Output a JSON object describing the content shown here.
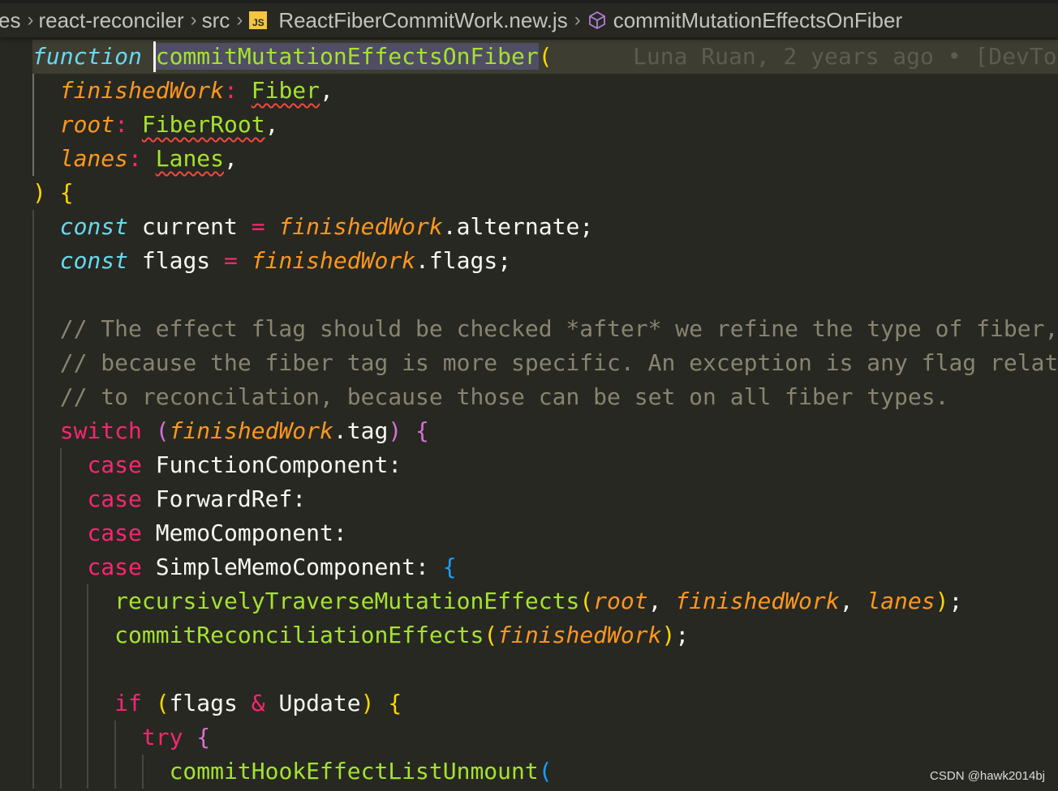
{
  "breadcrumb": {
    "items": [
      "es",
      "react-reconciler",
      "src",
      "ReactFiberCommitWork.new.js",
      "commitMutationEffectsOnFiber"
    ],
    "file_icon_label": "JS",
    "file_icon": "javascript-file-icon",
    "symbol_icon": "cube-symbol-icon"
  },
  "palette": {
    "fn": "#a6e22e",
    "kw": "#66d9ef",
    "param": "#fd971f",
    "pink": "#f92672",
    "txt": "#f8f8f2",
    "cm": "#88846f",
    "b1": "#ffd700",
    "b2": "#da70d6",
    "b3": "#179fff",
    "type": "#a6e22e"
  },
  "blame": "Luna Ruan, 2 years ago • [DevTo",
  "code": {
    "lines": [
      [
        [
          "function",
          "kw",
          1
        ],
        [
          " ",
          "txt"
        ],
        [
          "commitMutationEffectsOnFiber",
          "fn",
          0,
          "sel"
        ],
        [
          "(",
          "b1"
        ]
      ],
      [
        [
          "  ",
          "txt"
        ],
        [
          "finishedWork",
          "param",
          1
        ],
        [
          ":",
          "pink"
        ],
        [
          " ",
          "txt"
        ],
        [
          "Fiber",
          "type",
          0,
          "squig"
        ],
        [
          ",",
          "txt"
        ]
      ],
      [
        [
          "  ",
          "txt"
        ],
        [
          "root",
          "param",
          1
        ],
        [
          ":",
          "pink"
        ],
        [
          " ",
          "txt"
        ],
        [
          "FiberRoot",
          "type",
          0,
          "squig"
        ],
        [
          ",",
          "txt"
        ]
      ],
      [
        [
          "  ",
          "txt"
        ],
        [
          "lanes",
          "param",
          1
        ],
        [
          ":",
          "pink"
        ],
        [
          " ",
          "txt"
        ],
        [
          "Lanes",
          "type",
          0,
          "squig"
        ],
        [
          ",",
          "txt"
        ]
      ],
      [
        [
          ")",
          "b1"
        ],
        [
          " ",
          "txt"
        ],
        [
          "{",
          "b1"
        ]
      ],
      [
        [
          "  ",
          "txt"
        ],
        [
          "const",
          "kw",
          1
        ],
        [
          " current ",
          "txt"
        ],
        [
          "=",
          "pink"
        ],
        [
          " ",
          "txt"
        ],
        [
          "finishedWork",
          "param",
          1
        ],
        [
          ".alternate;",
          "txt"
        ]
      ],
      [
        [
          "  ",
          "txt"
        ],
        [
          "const",
          "kw",
          1
        ],
        [
          " flags ",
          "txt"
        ],
        [
          "=",
          "pink"
        ],
        [
          " ",
          "txt"
        ],
        [
          "finishedWork",
          "param",
          1
        ],
        [
          ".flags;",
          "txt"
        ]
      ],
      [],
      [
        [
          "  // The effect flag should be checked *after* we refine the type of fiber,",
          "cm"
        ]
      ],
      [
        [
          "  // because the fiber tag is more specific. An exception is any flag relat",
          "cm"
        ]
      ],
      [
        [
          "  // to reconcilation, because those can be set on all fiber types.",
          "cm"
        ]
      ],
      [
        [
          "  ",
          "txt"
        ],
        [
          "switch",
          "pink"
        ],
        [
          " ",
          "txt"
        ],
        [
          "(",
          "b2"
        ],
        [
          "finishedWork",
          "param",
          1
        ],
        [
          ".tag",
          "txt"
        ],
        [
          ")",
          "b2"
        ],
        [
          " ",
          "txt"
        ],
        [
          "{",
          "b2"
        ]
      ],
      [
        [
          "    ",
          "txt"
        ],
        [
          "case",
          "pink"
        ],
        [
          " FunctionComponent:",
          "txt"
        ]
      ],
      [
        [
          "    ",
          "txt"
        ],
        [
          "case",
          "pink"
        ],
        [
          " ForwardRef:",
          "txt"
        ]
      ],
      [
        [
          "    ",
          "txt"
        ],
        [
          "case",
          "pink"
        ],
        [
          " MemoComponent:",
          "txt"
        ]
      ],
      [
        [
          "    ",
          "txt"
        ],
        [
          "case",
          "pink"
        ],
        [
          " SimpleMemoComponent: ",
          "txt"
        ],
        [
          "{",
          "b3"
        ]
      ],
      [
        [
          "      ",
          "txt"
        ],
        [
          "recursivelyTraverseMutationEffects",
          "fn"
        ],
        [
          "(",
          "b1"
        ],
        [
          "root",
          "param",
          1
        ],
        [
          ", ",
          "txt"
        ],
        [
          "finishedWork",
          "param",
          1
        ],
        [
          ", ",
          "txt"
        ],
        [
          "lanes",
          "param",
          1
        ],
        [
          ")",
          "b1"
        ],
        [
          ";",
          "txt"
        ]
      ],
      [
        [
          "      ",
          "txt"
        ],
        [
          "commitReconciliationEffects",
          "fn"
        ],
        [
          "(",
          "b1"
        ],
        [
          "finishedWork",
          "param",
          1
        ],
        [
          ")",
          "b1"
        ],
        [
          ";",
          "txt"
        ]
      ],
      [],
      [
        [
          "      ",
          "txt"
        ],
        [
          "if",
          "pink"
        ],
        [
          " ",
          "txt"
        ],
        [
          "(",
          "b1"
        ],
        [
          "flags ",
          "txt"
        ],
        [
          "&",
          "pink"
        ],
        [
          " Update",
          "txt"
        ],
        [
          ")",
          "b1"
        ],
        [
          " ",
          "txt"
        ],
        [
          "{",
          "b1"
        ]
      ],
      [
        [
          "        ",
          "txt"
        ],
        [
          "try",
          "pink"
        ],
        [
          " ",
          "txt"
        ],
        [
          "{",
          "b2"
        ]
      ],
      [
        [
          "          ",
          "txt"
        ],
        [
          "commitHookEffectListUnmount",
          "fn"
        ],
        [
          "(",
          "b3"
        ]
      ]
    ]
  },
  "watermark": "CSDN @hawk2014bj"
}
